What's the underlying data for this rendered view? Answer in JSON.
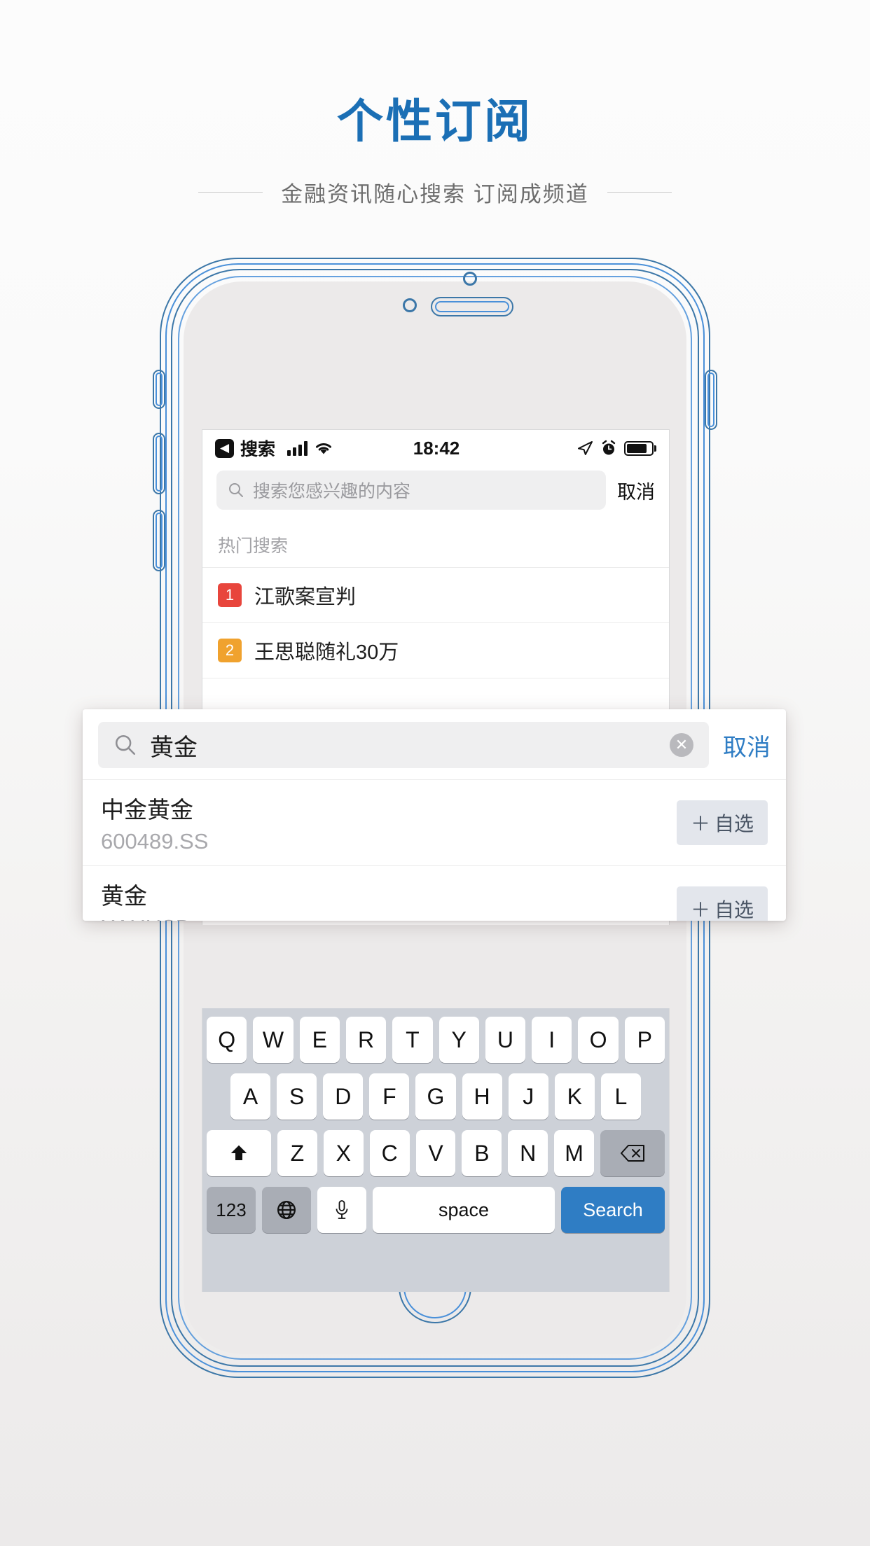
{
  "header": {
    "title": "个性订阅",
    "subtitle": "金融资讯随心搜索 订阅成频道"
  },
  "colors": {
    "brand_blue": "#1b6fb5",
    "accent_blue": "#2f7dc4",
    "frame_blue": "#3c77a8",
    "rank1_red": "#e8453c",
    "rank2_orange": "#f0a22e",
    "keyboard_bg": "#cdd1d8"
  },
  "phone": {
    "status_bar": {
      "back_icon": "back-chevron-icon",
      "app_name": "搜索",
      "signal_icon": "signal-bars-icon",
      "wifi_icon": "wifi-icon",
      "time": "18:42",
      "location_icon": "location-arrow-icon",
      "alarm_icon": "alarm-clock-icon",
      "battery_icon": "battery-icon"
    },
    "search": {
      "icon": "search-icon",
      "placeholder": "搜索您感兴趣的内容",
      "cancel_label": "取消"
    },
    "hot_search": {
      "title": "热门搜索",
      "items": [
        {
          "rank": "1",
          "label": "江歌案宣判",
          "color": "#e8453c"
        },
        {
          "rank": "2",
          "label": "王思聪随礼30万",
          "color": "#f0a22e"
        }
      ]
    }
  },
  "overlay": {
    "search": {
      "icon": "search-icon",
      "value": "黄金",
      "clear_icon": "clear-circle-icon",
      "cancel_label": "取消"
    },
    "results": [
      {
        "name": "中金黄金",
        "code": "600489.SS",
        "action": "自选",
        "action_prefix": "＋"
      },
      {
        "name": "黄金",
        "code": "XAUUSD",
        "action": "自选",
        "action_prefix": "＋"
      }
    ]
  },
  "keyboard": {
    "row1": [
      "Q",
      "W",
      "E",
      "R",
      "T",
      "Y",
      "U",
      "I",
      "O",
      "P"
    ],
    "row2": [
      "A",
      "S",
      "D",
      "F",
      "G",
      "H",
      "J",
      "K",
      "L"
    ],
    "row3": [
      "Z",
      "X",
      "C",
      "V",
      "B",
      "N",
      "M"
    ],
    "shift_icon": "shift-arrow-icon",
    "backspace_icon": "backspace-icon",
    "numeric_label": "123",
    "globe_icon": "globe-icon",
    "mic_icon": "microphone-icon",
    "space_label": "space",
    "search_label": "Search"
  }
}
